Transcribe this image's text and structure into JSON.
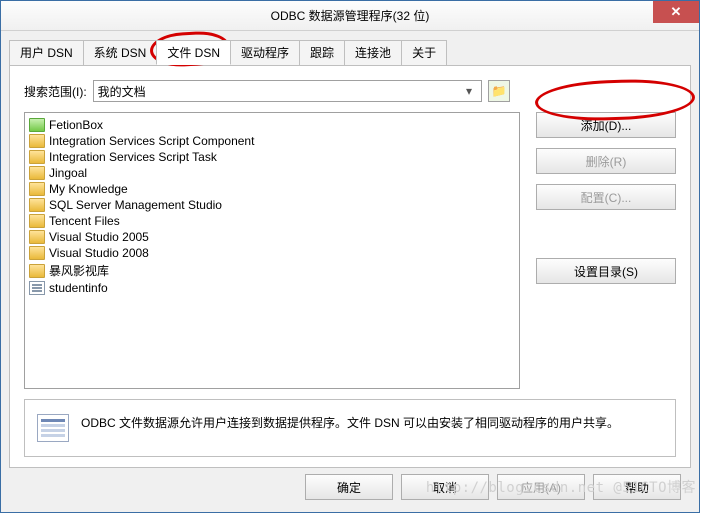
{
  "window": {
    "title": "ODBC 数据源管理程序(32 位)"
  },
  "tabs": [
    "用户 DSN",
    "系统 DSN",
    "文件 DSN",
    "驱动程序",
    "跟踪",
    "连接池",
    "关于"
  ],
  "active_tab_index": 2,
  "search": {
    "label": "搜索范围(I):",
    "value": "我的文档"
  },
  "folders": [
    {
      "name": "FetionBox",
      "kind": "folder-green"
    },
    {
      "name": "Integration Services Script Component",
      "kind": "folder"
    },
    {
      "name": "Integration Services Script Task",
      "kind": "folder"
    },
    {
      "name": "Jingoal",
      "kind": "folder"
    },
    {
      "name": "My Knowledge",
      "kind": "folder"
    },
    {
      "name": "SQL Server Management Studio",
      "kind": "folder"
    },
    {
      "name": "Tencent Files",
      "kind": "folder"
    },
    {
      "name": "Visual Studio 2005",
      "kind": "folder"
    },
    {
      "name": "Visual Studio 2008",
      "kind": "folder"
    },
    {
      "name": "暴风影视库",
      "kind": "folder"
    },
    {
      "name": "studentinfo",
      "kind": "file"
    }
  ],
  "side_buttons": {
    "add": "添加(D)...",
    "remove": "删除(R)",
    "configure": "配置(C)...",
    "set_dir": "设置目录(S)"
  },
  "info": "ODBC 文件数据源允许用户连接到数据提供程序。文件 DSN 可以由安装了相同驱动程序的用户共享。",
  "dialog_buttons": {
    "ok": "确定",
    "cancel": "取消",
    "apply": "应用(A)",
    "help": "帮助"
  },
  "watermark": "http://blog.csdn.net @51CTO博客"
}
